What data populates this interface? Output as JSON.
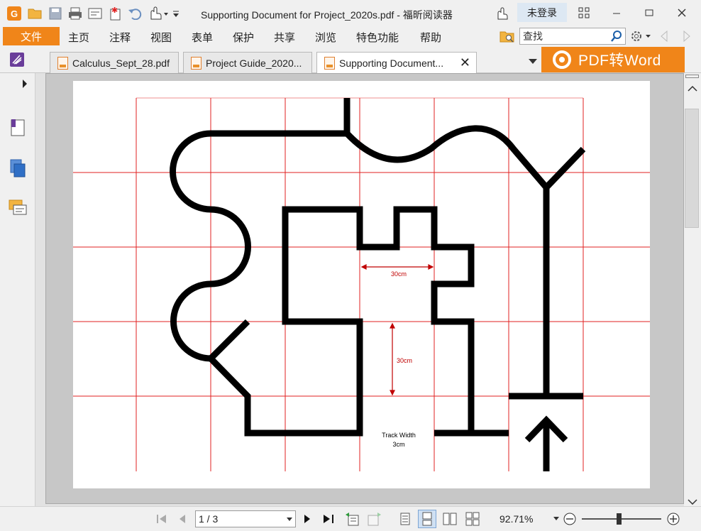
{
  "window": {
    "title": "Supporting Document for Project_2020s.pdf - 福昕阅读器",
    "login_label": "未登录"
  },
  "menu": {
    "file": "文件",
    "items": [
      "主页",
      "注释",
      "视图",
      "表单",
      "保护",
      "共享",
      "浏览",
      "特色功能",
      "帮助"
    ],
    "search_placeholder": "查找"
  },
  "tabs": [
    {
      "label": "Calculus_Sept_28.pdf",
      "active": false
    },
    {
      "label": "Project Guide_2020...",
      "active": false
    },
    {
      "label": "Supporting Document...",
      "active": true
    }
  ],
  "promo": {
    "label": "PDF转Word"
  },
  "document": {
    "dim_horizontal": "30cm",
    "dim_vertical": "30cm",
    "track_label_line1": "Track Width",
    "track_label_line2": "3cm"
  },
  "status": {
    "page_indicator": "1 / 3",
    "zoom": "92.71%"
  },
  "colors": {
    "accent": "#f08519",
    "grid": "#e02020",
    "track": "#000000"
  }
}
